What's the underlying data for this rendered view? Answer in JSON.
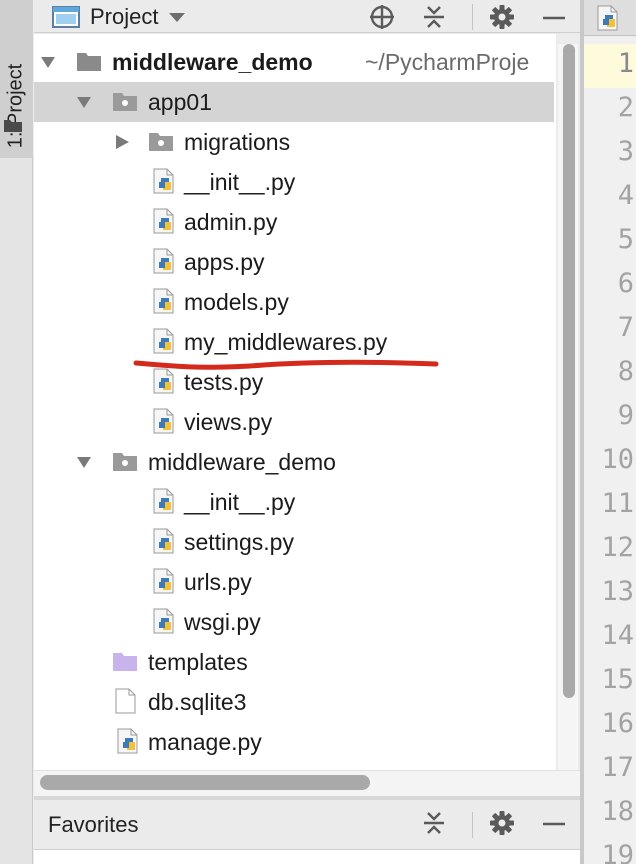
{
  "side_strip": {
    "tab_label": "1: Project",
    "tab_icon": "folder-icon"
  },
  "project_header": {
    "title": "Project",
    "icons": [
      "window-icon",
      "chevron-down-icon",
      "locate-crosshair-icon",
      "collapse-all-icon",
      "gear-icon",
      "minimize-icon"
    ]
  },
  "tree": [
    {
      "label": "middleware_demo",
      "path": "~/PycharmProje",
      "kind": "root-folder",
      "expanded": true,
      "depth": 0
    },
    {
      "label": "app01",
      "kind": "package-folder",
      "expanded": true,
      "depth": 1,
      "selected": true
    },
    {
      "label": "migrations",
      "kind": "package-folder",
      "expanded": false,
      "depth": 2
    },
    {
      "label": "__init__.py",
      "kind": "python-file",
      "depth": 2
    },
    {
      "label": "admin.py",
      "kind": "python-file",
      "depth": 2
    },
    {
      "label": "apps.py",
      "kind": "python-file",
      "depth": 2
    },
    {
      "label": "models.py",
      "kind": "python-file",
      "depth": 2
    },
    {
      "label": "my_middlewares.py",
      "kind": "python-file",
      "depth": 2,
      "underlined": true
    },
    {
      "label": "tests.py",
      "kind": "python-file",
      "depth": 2
    },
    {
      "label": "views.py",
      "kind": "python-file",
      "depth": 2
    },
    {
      "label": "middleware_demo",
      "kind": "package-folder",
      "expanded": true,
      "depth": 1
    },
    {
      "label": "__init__.py",
      "kind": "python-file",
      "depth": 2
    },
    {
      "label": "settings.py",
      "kind": "python-file",
      "depth": 2
    },
    {
      "label": "urls.py",
      "kind": "python-file",
      "depth": 2
    },
    {
      "label": "wsgi.py",
      "kind": "python-file",
      "depth": 2
    },
    {
      "label": "templates",
      "kind": "templates-folder",
      "depth": 1
    },
    {
      "label": "db.sqlite3",
      "kind": "plain-file",
      "depth": 1
    },
    {
      "label": "manage.py",
      "kind": "python-file",
      "depth": 1
    }
  ],
  "favorites": {
    "title": "Favorites",
    "icons": [
      "collapse-all-icon",
      "gear-icon",
      "minimize-icon"
    ]
  },
  "editor": {
    "line_numbers": [
      "1",
      "2",
      "3",
      "4",
      "5",
      "6",
      "7",
      "8",
      "9",
      "10",
      "11",
      "12",
      "13",
      "14",
      "15",
      "16",
      "17",
      "18",
      "19"
    ],
    "current_line": "1",
    "tab_icon": "python-file-icon"
  },
  "colors": {
    "selection": "#d4d4d4",
    "annotation_stroke": "#d42a1e",
    "python_blue": "#3d7ab8",
    "python_yellow": "#f3c23a",
    "templates_folder": "#c9b3ec",
    "current_line_bg": "#fefbdc"
  }
}
